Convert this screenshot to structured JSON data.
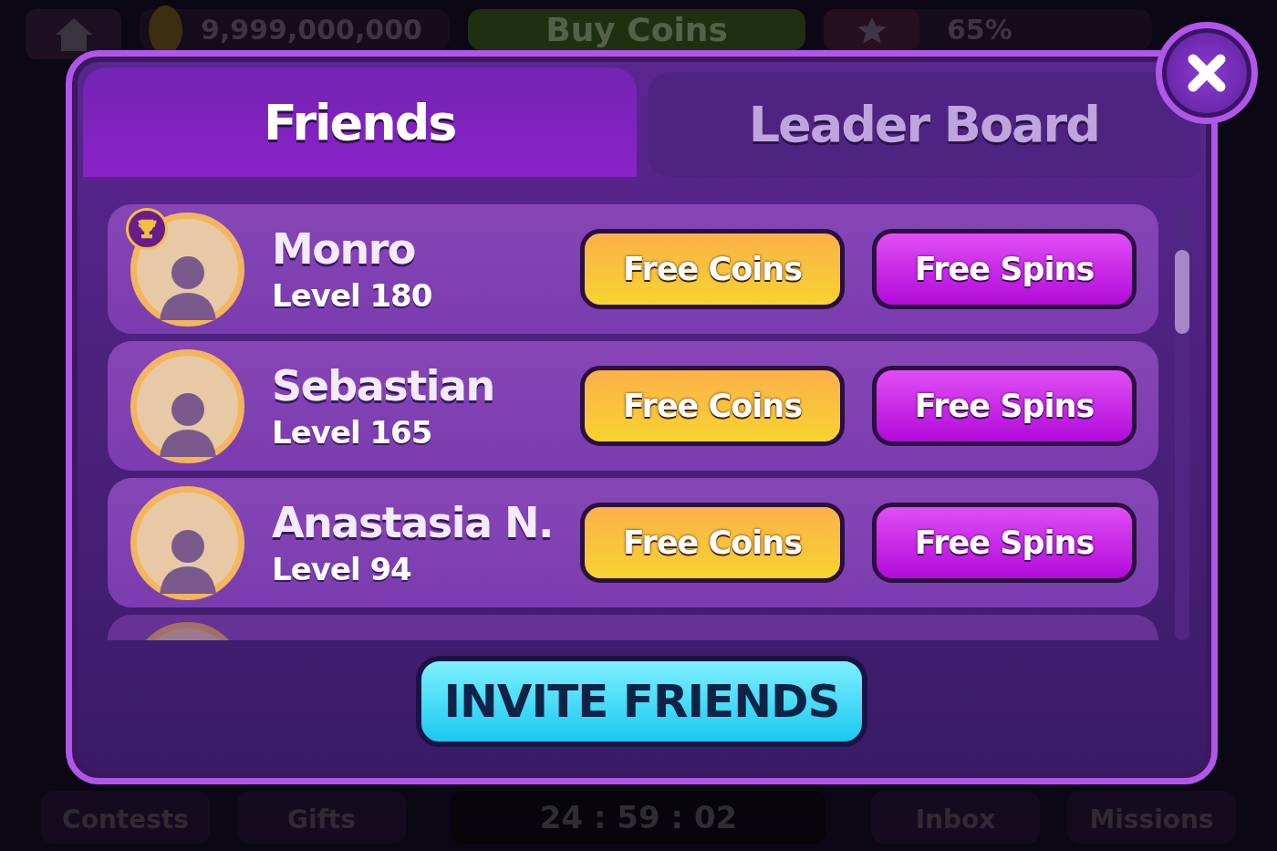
{
  "top_bar": {
    "balance": "9,999,000,000",
    "buy_button": "Buy Coins",
    "level_progress": "65%"
  },
  "tabs": [
    {
      "label": "Friends",
      "selected": true
    },
    {
      "label": "Leader Board",
      "selected": false
    }
  ],
  "friends": [
    {
      "name": "Monro",
      "level": "Level 180",
      "trophy": true,
      "coins_button": "Free Coins",
      "spins_button": "Free Spins"
    },
    {
      "name": "Sebastian",
      "level": "Level 165",
      "trophy": false,
      "coins_button": "Free Coins",
      "spins_button": "Free Spins"
    },
    {
      "name": "Anastasia N.",
      "level": "Level 94",
      "trophy": false,
      "coins_button": "Free Coins",
      "spins_button": "Free Spins"
    }
  ],
  "invite_button": "INVITE FRIENDS",
  "bottom_bar": {
    "left": [
      "Contests",
      "Gifts"
    ],
    "timer": "24 : 59 : 02",
    "right": [
      "Inbox",
      "Missions"
    ]
  }
}
